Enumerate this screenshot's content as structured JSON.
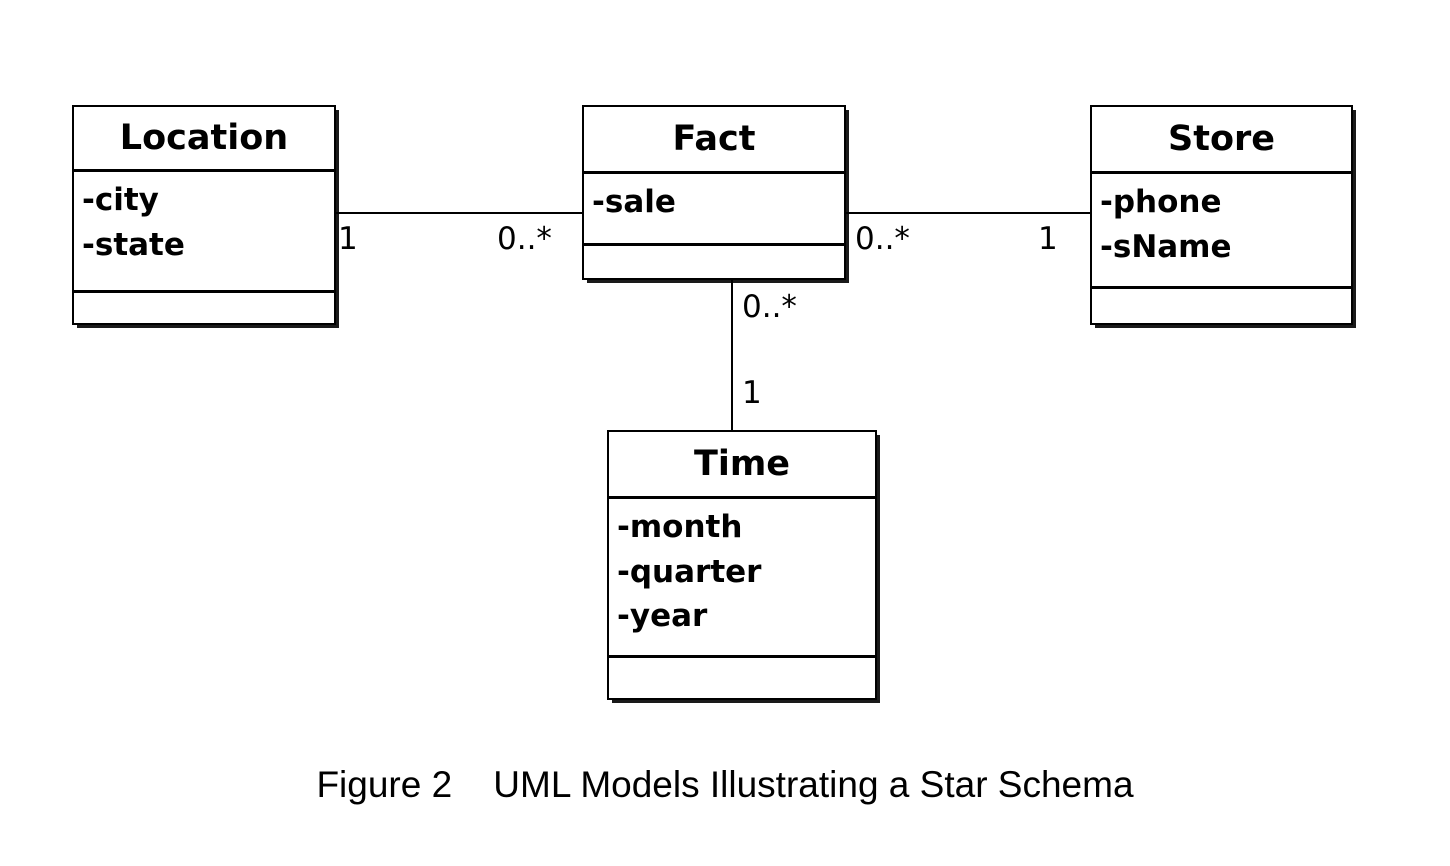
{
  "figure": {
    "caption": "Figure 2    UML Models Illustrating a Star Schema",
    "ink_color": "#000000",
    "background_color": "#ffffff"
  },
  "classes": {
    "location": {
      "name": "Location",
      "attributes": [
        "-city",
        "-state"
      ],
      "operations": []
    },
    "fact": {
      "name": "Fact",
      "attributes": [
        "-sale"
      ],
      "operations": []
    },
    "store": {
      "name": "Store",
      "attributes": [
        "-phone",
        "-sName"
      ],
      "operations": []
    },
    "time": {
      "name": "Time",
      "attributes": [
        "-month",
        "-quarter",
        "-year"
      ],
      "operations": []
    }
  },
  "associations": {
    "location_fact": {
      "source_multiplicity": "1",
      "target_multiplicity": "0..*"
    },
    "fact_store": {
      "source_multiplicity": "0..*",
      "target_multiplicity": "1"
    },
    "fact_time": {
      "source_multiplicity": "0..*",
      "target_multiplicity": "1"
    }
  }
}
